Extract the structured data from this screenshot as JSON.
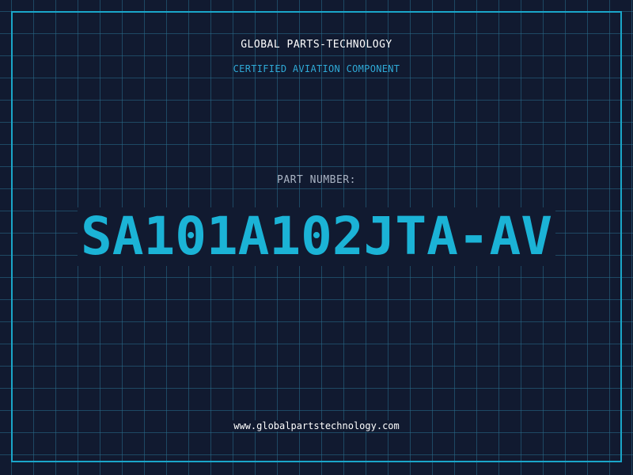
{
  "company_name": "GLOBAL PARTS-TECHNOLOGY",
  "subtitle": "CERTIFIED AVIATION COMPONENT",
  "part_label": "PART NUMBER:",
  "part_number": "SA101A102JTA-AV",
  "website": "www.globalpartstechnology.com",
  "colors": {
    "background": "#111a30",
    "grid": "#286e8c",
    "frame": "#1aa6c9",
    "accent": "#1bb3d6",
    "label": "#aab4c4",
    "text": "#ffffff"
  }
}
